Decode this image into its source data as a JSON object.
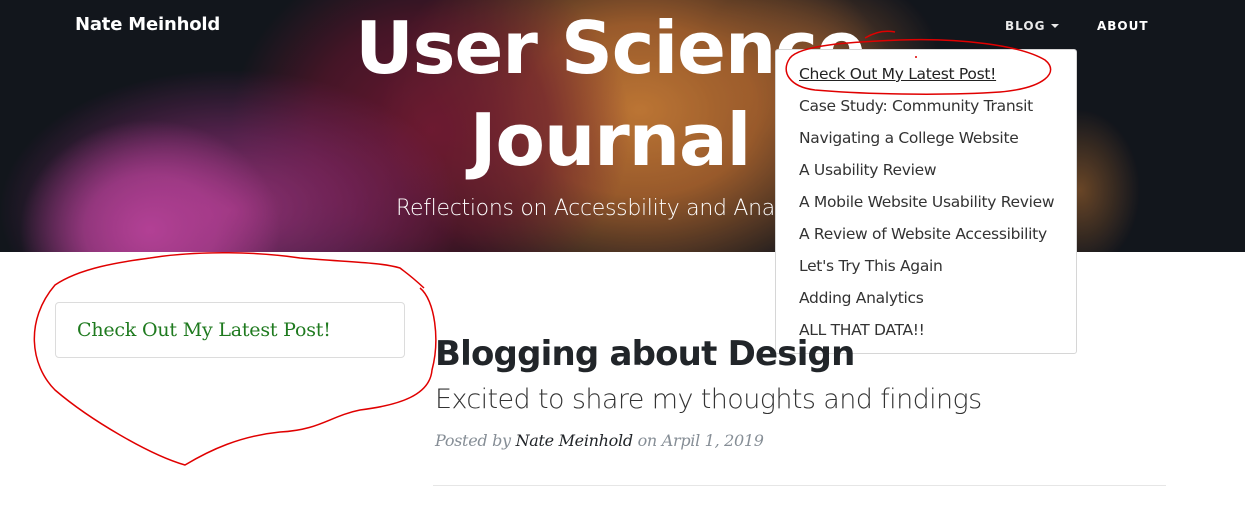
{
  "header": {
    "brand": "Nate Meinhold",
    "title": "User Science Journal",
    "subtitle": "Reflections on Accessbility and Analytics",
    "nav": {
      "blog_label": "BLOG",
      "about_label": "ABOUT"
    }
  },
  "dropdown": {
    "items": [
      {
        "label": "Check Out My Latest Post!",
        "active": true
      },
      {
        "label": "Case Study: Community Transit"
      },
      {
        "label": "Navigating a College Website"
      },
      {
        "label": "A Usability Review"
      },
      {
        "label": "A Mobile Website Usability Review"
      },
      {
        "label": "A Review of Website Accessibility"
      },
      {
        "label": "Let's Try This Again"
      },
      {
        "label": "Adding Analytics"
      },
      {
        "label": "ALL THAT DATA!!"
      }
    ]
  },
  "sidebar": {
    "latest_link": "Check Out My Latest Post!"
  },
  "post": {
    "title": "Blogging about Design",
    "subtitle": "Excited to share my thoughts and findings",
    "meta_prefix": "Posted by",
    "author": "Nate Meinhold",
    "meta_mid": "on",
    "date": "Arpil 1, 2019"
  },
  "colors": {
    "link_green": "#1f7a1f",
    "annotation_red": "#e00000",
    "heading_dark": "#212529",
    "meta_gray": "#868e96"
  }
}
